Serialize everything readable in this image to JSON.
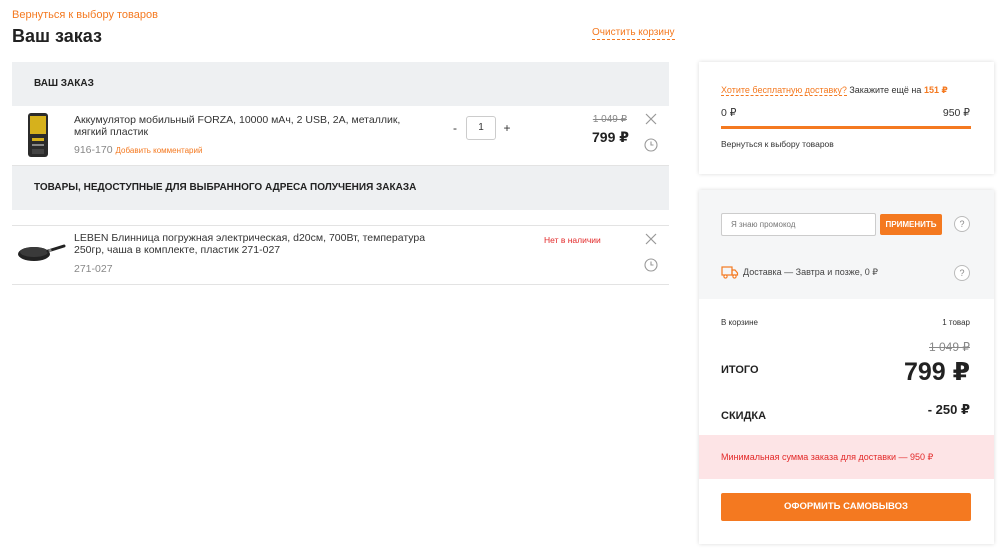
{
  "header": {
    "back_link": "Вернуться к выбору товаров",
    "title": "Ваш заказ",
    "clear_cart": "Очистить корзину"
  },
  "order_section": {
    "heading": "ВАШ ЗАКАЗ",
    "items": [
      {
        "name": "Аккумулятор мобильный FORZA, 10000 мАч, 2 USB, 2A, металлик, мягкий пластик",
        "code": "916-170",
        "add_comment": "Добавить комментарий",
        "qty_minus": "-",
        "quantity": "1",
        "qty_plus": "+",
        "old_price": "1 049 ₽",
        "price": "799 ₽"
      }
    ]
  },
  "unavailable_section": {
    "heading": "ТОВАРЫ, НЕДОСТУПНЫЕ ДЛЯ ВЫБРАННОГО АДРЕСА ПОЛУЧЕНИЯ ЗАКАЗА",
    "items": [
      {
        "name": "LEBEN Блинница погружная электрическая, d20см, 700Вт, температура 250гр, чаша в комплекте, пластик 271-027",
        "code": "271-027",
        "status": "Нет в наличии"
      }
    ]
  },
  "free_delivery": {
    "link_text": "Хотите бесплатную доставку?",
    "text": "Закажите ещё на",
    "amount": "151 ₽",
    "bar_min": "0 ₽",
    "bar_max": "950 ₽",
    "progress_percent": 100,
    "back_link": "Вернуться к выбору товаров"
  },
  "summary": {
    "promo_placeholder": "Я знаю промокод",
    "promo_button": "ПРИМЕНИТЬ",
    "help": "?",
    "delivery": "Доставка — Завтра и позже, 0 ₽",
    "in_cart_label": "В корзине",
    "in_cart_value": "1 товар",
    "total_old": "1 049 ₽",
    "total_label": "ИТОГО",
    "total_value": "799 ₽",
    "discount_label": "СКИДКА",
    "discount_value": "- 250 ₽",
    "warning": "Минимальная сумма заказа для доставки — 950 ₽",
    "checkout_button": "ОФОРМИТЬ САМОВЫВОЗ"
  },
  "colors": {
    "accent": "#f47920",
    "error": "#e32a2a",
    "warning_bg": "#fde4e6",
    "section_bg": "#eef0f2"
  },
  "icons": [
    "close-icon",
    "clock-icon",
    "truck-icon",
    "question-icon"
  ]
}
